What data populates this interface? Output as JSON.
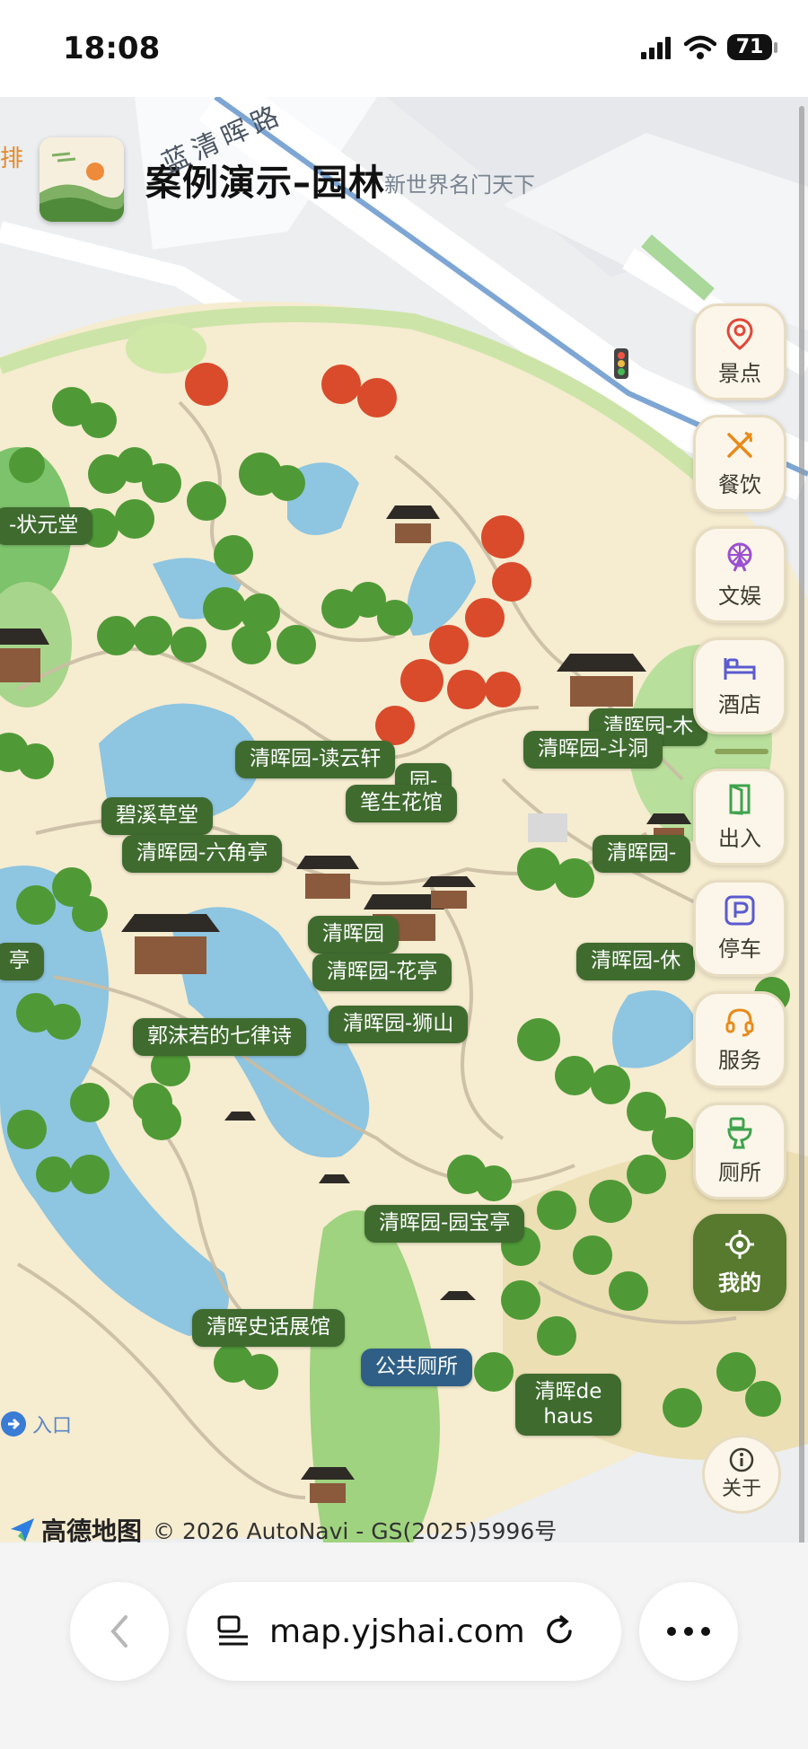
{
  "status_bar": {
    "time": "18:08",
    "battery": "71"
  },
  "header": {
    "title": "案例演示–园林"
  },
  "streets": {
    "road_name": "蓝清晖路",
    "road_name_2": "新世界名门天下",
    "edge_text": "排"
  },
  "pois": [
    {
      "label": "-状元堂",
      "style": "green"
    },
    {
      "label": "清晖园-读云轩",
      "style": "green"
    },
    {
      "label": "清晖园-木",
      "style": "green"
    },
    {
      "label": "清晖园-斗洞",
      "style": "green"
    },
    {
      "label": "园-",
      "style": "green"
    },
    {
      "label": "笔生花馆",
      "style": "green"
    },
    {
      "label": "碧溪草堂",
      "style": "green"
    },
    {
      "label": "清晖园-六角亭",
      "style": "green"
    },
    {
      "label": "清晖园-",
      "style": "green"
    },
    {
      "label": "清晖园",
      "style": "green"
    },
    {
      "label": "亭",
      "style": "green"
    },
    {
      "label": "清晖园-花亭",
      "style": "green"
    },
    {
      "label": "清晖园-休",
      "style": "green"
    },
    {
      "label": "清晖园-狮山",
      "style": "green"
    },
    {
      "label": "郭沫若的七律诗",
      "style": "green"
    },
    {
      "label": "清晖园-园宝亭",
      "style": "green"
    },
    {
      "label": "清晖史话展馆",
      "style": "green"
    },
    {
      "label": "公共厕所",
      "style": "blue"
    },
    {
      "label": "清晖de haus",
      "style": "green"
    }
  ],
  "sidebar": {
    "items": [
      {
        "label": "景点",
        "icon": "location-pin-icon"
      },
      {
        "label": "餐饮",
        "icon": "fork-knife-icon"
      },
      {
        "label": "文娱",
        "icon": "ferris-wheel-icon"
      },
      {
        "label": "酒店",
        "icon": "bed-icon"
      },
      {
        "label": "出入",
        "icon": "door-icon"
      },
      {
        "label": "停车",
        "icon": "parking-icon"
      },
      {
        "label": "服务",
        "icon": "headset-icon"
      },
      {
        "label": "厕所",
        "icon": "toilet-icon"
      },
      {
        "label": "我的",
        "icon": "locate-icon",
        "active": true
      }
    ],
    "about": {
      "label": "关于",
      "icon": "info-icon"
    }
  },
  "map_misc": {
    "entrance_text": "入口"
  },
  "attribution": {
    "brand": "高德地图",
    "text": "© 2026 AutoNavi - GS(2025)5996号"
  },
  "browser": {
    "url": "map.yjshai.com"
  },
  "colors": {
    "poi_green": "#3f6b2f",
    "poi_blue": "#2f5f86",
    "active_button": "#577a2f",
    "water": "#8ec5e0",
    "land": "#f5ecd0"
  }
}
